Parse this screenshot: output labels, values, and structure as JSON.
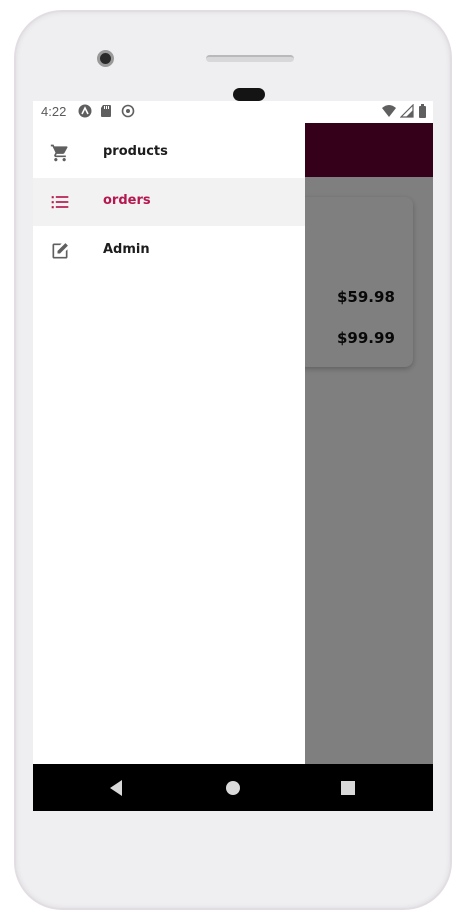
{
  "status_bar": {
    "time": "4:22",
    "left_icons": [
      "android-icon",
      "sd-card-icon",
      "sync-icon"
    ],
    "right_icons": [
      "wifi-icon",
      "signal-icon",
      "battery-icon"
    ]
  },
  "orders": {
    "prices": [
      "$59.98",
      "$99.99"
    ]
  },
  "drawer": {
    "items": [
      {
        "label": "products",
        "icon": "cart-icon",
        "selected": false
      },
      {
        "label": "orders",
        "icon": "list-icon",
        "selected": true
      },
      {
        "label": "Admin",
        "icon": "edit-icon",
        "selected": false
      }
    ]
  },
  "colors": {
    "appbar": "#6a0035",
    "accent": "#b5174f",
    "icon": "#5f5f5f"
  },
  "nav_bar": {
    "buttons": [
      "back-icon",
      "home-icon",
      "recents-icon"
    ]
  }
}
